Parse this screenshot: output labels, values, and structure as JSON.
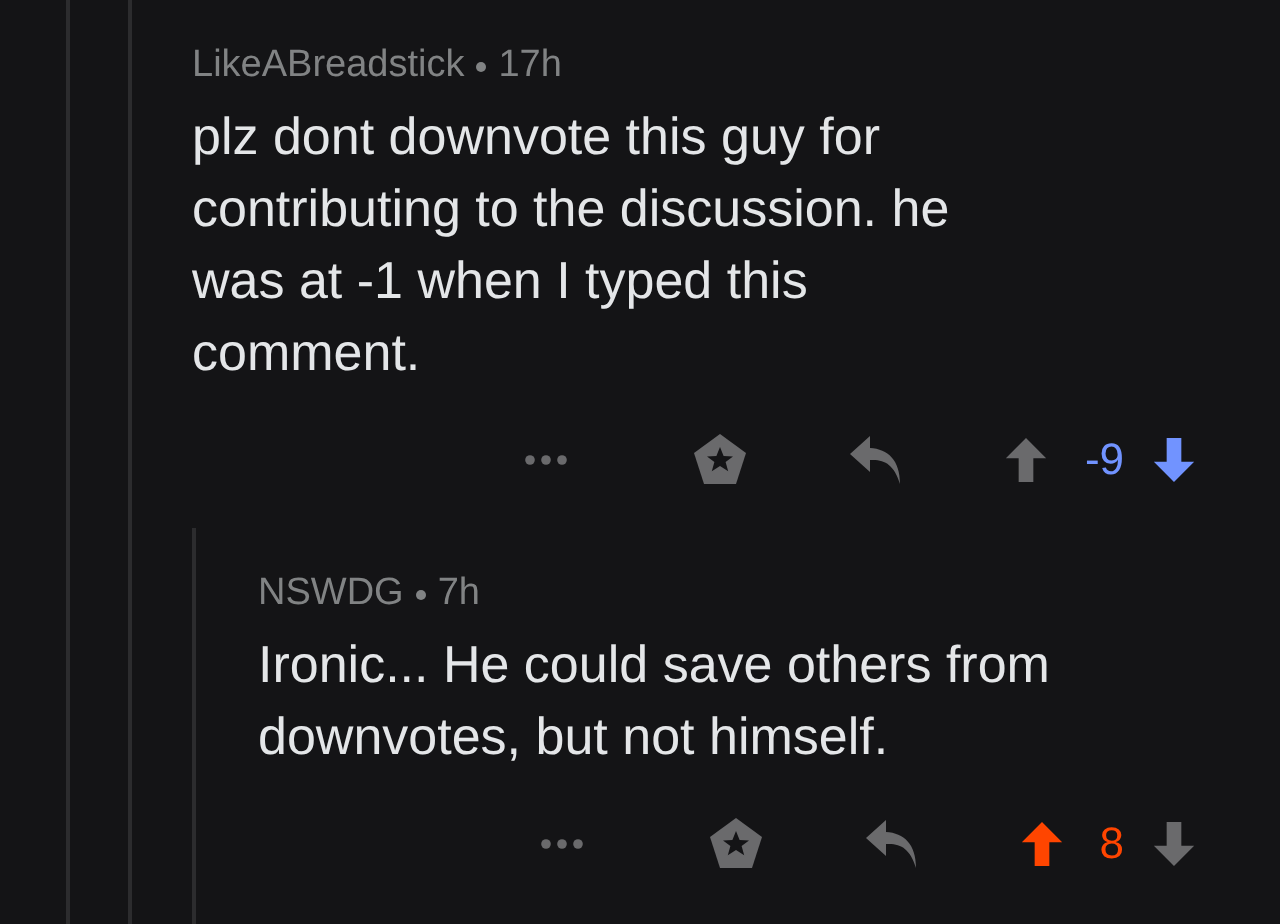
{
  "comments": [
    {
      "author": "LikeABreadstick",
      "age": "17h",
      "body": "plz dont downvote this guy for contributing to the discussion. he was at -1 when I typed this comment.",
      "score": "-9",
      "upvoted": false,
      "downvoted": true,
      "children": [
        {
          "author": "NSWDG",
          "age": "7h",
          "body": "Ironic... He could save others from downvotes, but not himself.",
          "score": "8",
          "upvoted": true,
          "downvoted": false
        }
      ]
    }
  ]
}
